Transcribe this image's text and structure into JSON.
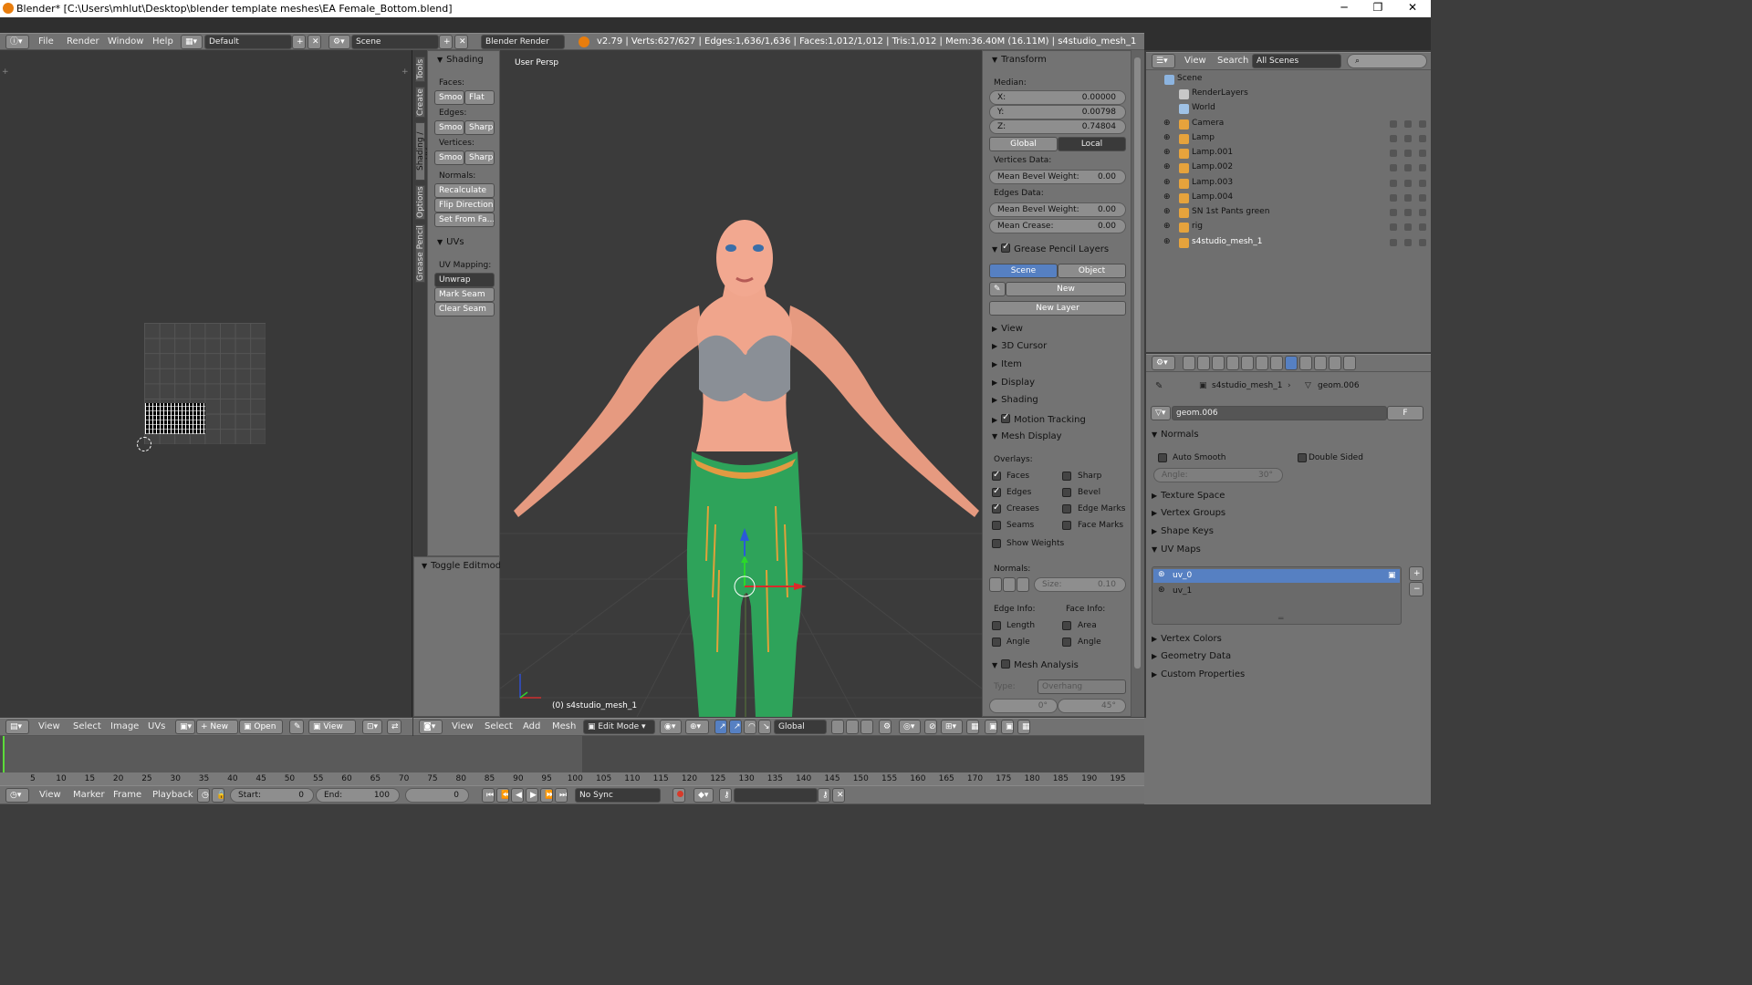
{
  "title": "Blender* [C:\\Users\\mhlut\\Desktop\\blender template meshes\\EA Female_Bottom.blend]",
  "info": {
    "menus": [
      "File",
      "Render",
      "Window",
      "Help"
    ],
    "layout": "Default",
    "scene": "Scene",
    "engine": "Blender Render",
    "stats": "v2.79 | Verts:627/627 | Edges:1,636/1,636 | Faces:1,012/1,012 | Tris:1,012 | Mem:36.40M (16.11M) | s4studio_mesh_1"
  },
  "tool_tabs": [
    "Tools",
    "Create",
    "Shading / UVs",
    "Options",
    "Grease Pencil"
  ],
  "tools": {
    "shading_title": "Shading",
    "faces_label": "Faces:",
    "faces_smooth": "Smoo",
    "faces_flat": "Flat",
    "edges_label": "Edges:",
    "edges_smooth": "Smoo",
    "edges_sharp": "Sharp",
    "verts_label": "Vertices:",
    "verts_smooth": "Smoo",
    "verts_sharp": "Sharp",
    "normals_label": "Normals:",
    "recalculate": "Recalculate",
    "flip": "Flip Direction",
    "set_from": "Set From Fa...",
    "uvs_title": "UVs",
    "uv_mapping": "UV Mapping:",
    "unwrap": "Unwrap",
    "mark_seam": "Mark Seam",
    "clear_seam": "Clear Seam",
    "toggle_editmode": "Toggle Editmode"
  },
  "viewport": {
    "persp": "User Persp",
    "object_label": "(0) s4studio_mesh_1"
  },
  "npanel": {
    "transform": "Transform",
    "median": "Median:",
    "x_label": "X:",
    "x": "0.00000",
    "y_label": "Y:",
    "y": "0.00798",
    "z_label": "Z:",
    "z": "0.74804",
    "global": "Global",
    "local": "Local",
    "vertices_data": "Vertices Data:",
    "mean_bevel_label": "Mean Bevel Weight:",
    "vert_bevel": "0.00",
    "edges_data": "Edges Data:",
    "edge_bevel": "0.00",
    "mean_crease_label": "Mean Crease:",
    "crease": "0.00",
    "gp_layers": "Grease Pencil Layers",
    "gp_scene": "Scene",
    "gp_object": "Object",
    "gp_new": "New",
    "gp_new_layer": "New Layer",
    "collapsed": [
      "View",
      "3D Cursor",
      "Item",
      "Display",
      "Shading"
    ],
    "motion_tracking": "Motion Tracking",
    "mesh_display": "Mesh Display",
    "overlays": "Overlays:",
    "ov_left": [
      {
        "label": "Faces",
        "checked": true
      },
      {
        "label": "Edges",
        "checked": true
      },
      {
        "label": "Creases",
        "checked": true
      },
      {
        "label": "Seams",
        "checked": false
      }
    ],
    "ov_right": [
      {
        "label": "Sharp",
        "checked": false
      },
      {
        "label": "Bevel",
        "checked": false
      },
      {
        "label": "Edge Marks",
        "checked": false
      },
      {
        "label": "Face Marks",
        "checked": false
      }
    ],
    "show_weights": "Show Weights",
    "normals": "Normals:",
    "size_label": "Size:",
    "size": "0.10",
    "edge_info": "Edge Info:",
    "face_info": "Face Info:",
    "length": "Length",
    "area": "Area",
    "angle": "Angle",
    "angle2": "Angle",
    "mesh_analysis": "Mesh Analysis",
    "type_label": "Type:",
    "type": "Overhang",
    "min": "0°",
    "max": "45°"
  },
  "outliner": {
    "view": "View",
    "search": "Search",
    "filter": "All Scenes",
    "items": [
      {
        "name": "Scene",
        "color": "#8cb4e0"
      },
      {
        "name": "RenderLayers",
        "color": "#c7c7c7"
      },
      {
        "name": "World",
        "color": "#9fc2e6"
      },
      {
        "name": "Camera",
        "color": "#e6a33c"
      },
      {
        "name": "Lamp",
        "color": "#e6a33c"
      },
      {
        "name": "Lamp.001",
        "color": "#e6a33c"
      },
      {
        "name": "Lamp.002",
        "color": "#e6a33c"
      },
      {
        "name": "Lamp.003",
        "color": "#e6a33c"
      },
      {
        "name": "Lamp.004",
        "color": "#e6a33c"
      },
      {
        "name": "SN 1st Pants green",
        "color": "#e6a33c"
      },
      {
        "name": "rig",
        "color": "#e6a33c"
      },
      {
        "name": "s4studio_mesh_1",
        "color": "#e6a33c"
      }
    ]
  },
  "props": {
    "crumb_obj": "s4studio_mesh_1",
    "crumb_mesh": "geom.006",
    "mesh_name": "geom.006",
    "f": "F",
    "normals": "Normals",
    "auto_smooth": "Auto Smooth",
    "double_sided": "Double Sided",
    "angle_label": "Angle:",
    "angle": "30°",
    "texture_space": "Texture Space",
    "vertex_groups": "Vertex Groups",
    "shape_keys": "Shape Keys",
    "uv_maps": "UV Maps",
    "uv_list": [
      "uv_0",
      "uv_1"
    ],
    "vertex_colors": "Vertex Colors",
    "geometry_data": "Geometry Data",
    "custom_props": "Custom Properties"
  },
  "uv_header": {
    "menus": [
      "View",
      "Select",
      "Image",
      "UVs"
    ],
    "new": "New",
    "open": "Open",
    "view": "View"
  },
  "v3d_header": {
    "menus": [
      "View",
      "Select",
      "Add",
      "Mesh"
    ],
    "mode": "Edit Mode",
    "orient": "Global"
  },
  "timeline": {
    "ticks": [
      "5",
      "10",
      "15",
      "20",
      "25",
      "30",
      "35",
      "40",
      "45",
      "50",
      "55",
      "60",
      "65",
      "70",
      "75",
      "80",
      "85",
      "90",
      "95",
      "100",
      "105",
      "110",
      "115",
      "120",
      "125",
      "130",
      "135",
      "140",
      "145",
      "150",
      "155",
      "160",
      "165",
      "170",
      "175",
      "180",
      "185",
      "190",
      "195"
    ],
    "menus": [
      "View",
      "Marker",
      "Frame",
      "Playback"
    ],
    "start_label": "Start:",
    "start": "0",
    "end_label": "End:",
    "end": "100",
    "current": "0",
    "sync": "No Sync"
  }
}
